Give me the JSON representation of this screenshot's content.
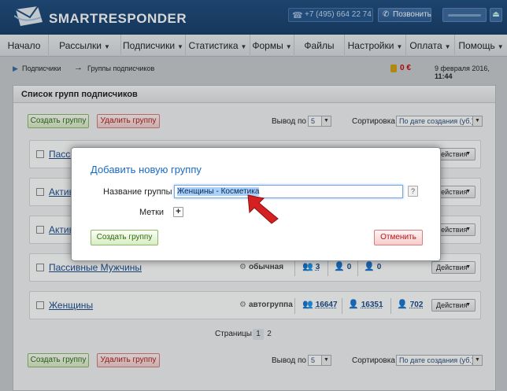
{
  "header": {
    "logo_text": "SMARTRESPONDER",
    "phone": "+7 (495) 664 22 74",
    "call_label": "Позвонить"
  },
  "nav": {
    "items": [
      {
        "label": "Начало",
        "dropdown": false
      },
      {
        "label": "Рассылки",
        "dropdown": true
      },
      {
        "label": "Подписчики",
        "dropdown": true
      },
      {
        "label": "Статистика",
        "dropdown": true
      },
      {
        "label": "Формы",
        "dropdown": true
      },
      {
        "label": "Файлы",
        "dropdown": false
      },
      {
        "label": "Настройки",
        "dropdown": true
      },
      {
        "label": "Оплата",
        "dropdown": true
      },
      {
        "label": "Помощь",
        "dropdown": true
      }
    ]
  },
  "breadcrumb": {
    "items": [
      "Подписчики",
      "Группы подписчиков"
    ],
    "separator": "→"
  },
  "status": {
    "balance": "0 €",
    "date": "9 февраля 2016,",
    "time": "11:44"
  },
  "panel": {
    "title": "Список групп подписчиков",
    "create_label": "Создать группу",
    "delete_label": "Удалить группу",
    "per_page_label": "Вывод по",
    "per_page_value": "5",
    "sort_label": "Сортировка",
    "sort_value": "По дате создания (уб.)",
    "actions_label": "Действия",
    "pages_label": "Страницы:",
    "pages": [
      "1",
      "2"
    ],
    "current_page": "1"
  },
  "groups": [
    {
      "name": "Пасси",
      "type": "",
      "s1": "",
      "s2": "",
      "s3": ""
    },
    {
      "name": "Актив",
      "type": "",
      "s1": "",
      "s2": "",
      "s3": ""
    },
    {
      "name": "Актив",
      "type": "",
      "s1": "",
      "s2": "",
      "s3": ""
    },
    {
      "name": "Пассивные Мужчины",
      "type": "обычная",
      "s1": "3",
      "s2": "0",
      "s3": "0"
    },
    {
      "name": "Женщины",
      "type": "автогруппа",
      "s1": "16647",
      "s2": "16351",
      "s3": "702"
    }
  ],
  "modal": {
    "title": "Добавить новую группу",
    "name_label": "Название группы",
    "required_mark": "*",
    "name_value": "Женщины - Косметика",
    "help_label": "?",
    "tags_label": "Метки",
    "add_tag_label": "+",
    "submit_label": "Создать группу",
    "cancel_label": "Отменить"
  },
  "colors": {
    "header_bg": "#1f4d80",
    "modal_title": "#1a6ac8",
    "link": "#1a4a8a",
    "balance": "#cc0000",
    "arrow": "#d42020"
  }
}
